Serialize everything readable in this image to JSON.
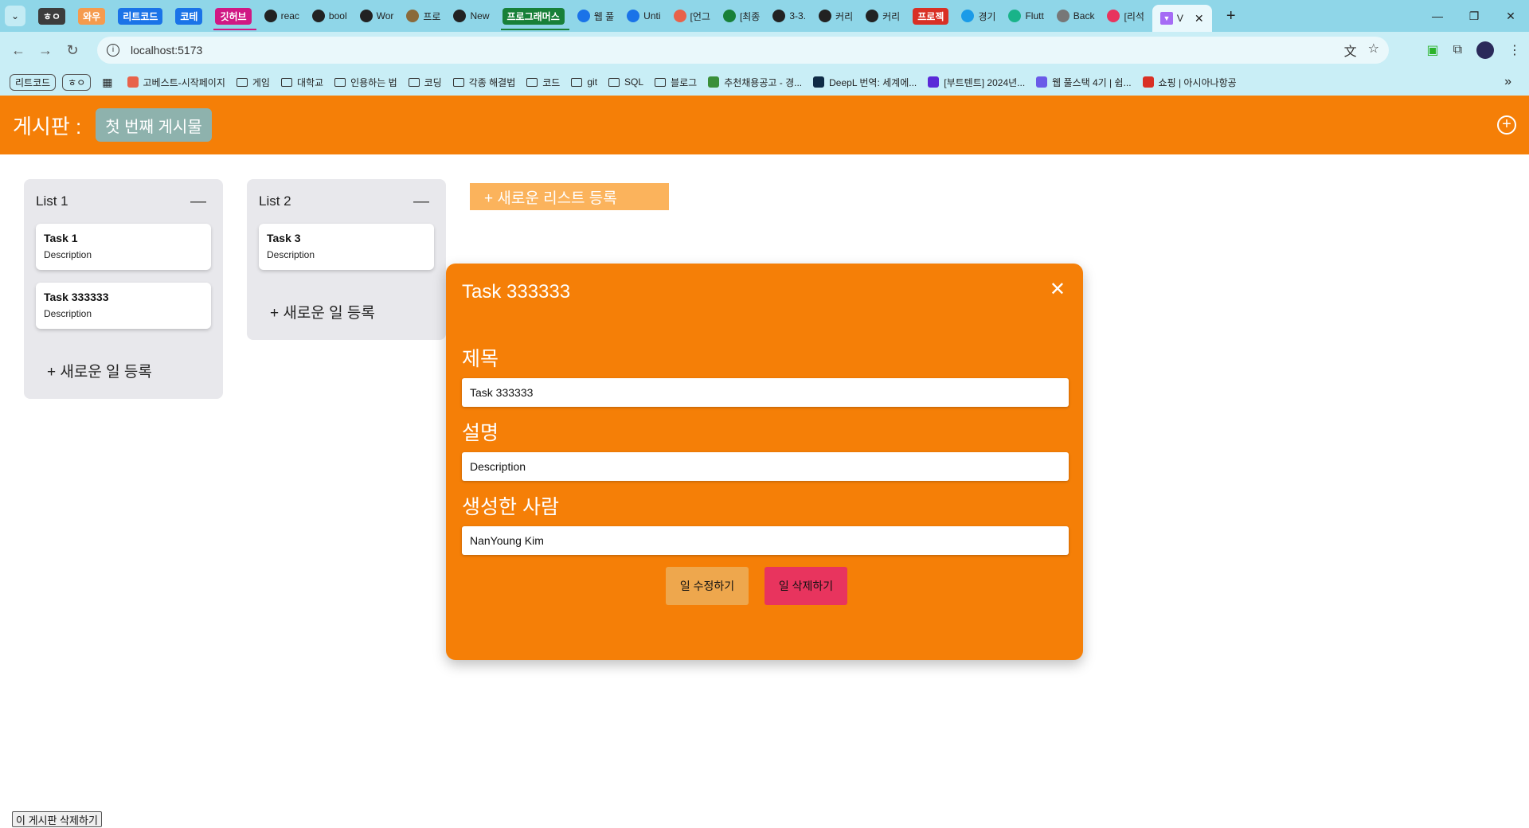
{
  "browser": {
    "tabs": [
      {
        "label": "ㅎㅇ",
        "kind": "badge",
        "bg": "#3c3c3c",
        "fg": "#ffffff"
      },
      {
        "label": "와우",
        "kind": "badge",
        "bg": "#f59b4e",
        "fg": "#ffffff"
      },
      {
        "label": "리트코드",
        "kind": "badge",
        "bg": "#1a73e8",
        "fg": "#ffffff"
      },
      {
        "label": "코테",
        "kind": "badge",
        "bg": "#1a73e8",
        "fg": "#ffffff"
      },
      {
        "label": "깃허브",
        "kind": "badge",
        "bg": "#d01884",
        "fg": "#ffffff",
        "underline": "#d01884"
      },
      {
        "label": "reac",
        "kind": "page",
        "icon": "github",
        "iconbg": "#222222"
      },
      {
        "label": "bool",
        "kind": "page",
        "icon": "github",
        "iconbg": "#222222"
      },
      {
        "label": "Wor",
        "kind": "page",
        "icon": "github",
        "iconbg": "#222222"
      },
      {
        "label": "프로",
        "kind": "page",
        "icon": "image",
        "iconbg": "#8a6a3a"
      },
      {
        "label": "New",
        "kind": "page",
        "icon": "github",
        "iconbg": "#222222"
      },
      {
        "label": "프로그래머스",
        "kind": "badge",
        "bg": "#188038",
        "fg": "#ffffff",
        "underline": "#188038"
      },
      {
        "label": "웹 풀",
        "kind": "page",
        "icon": "four",
        "iconbg": "#1a73e8"
      },
      {
        "label": "Unti",
        "kind": "page",
        "icon": "share",
        "iconbg": "#1a73e8"
      },
      {
        "label": "[언그",
        "kind": "page",
        "icon": "circle",
        "iconbg": "#e8624a"
      },
      {
        "label": "[최종",
        "kind": "page",
        "icon": "sheet",
        "iconbg": "#188038"
      },
      {
        "label": "3-3.",
        "kind": "page",
        "icon": "notion",
        "iconbg": "#222222"
      },
      {
        "label": "커리",
        "kind": "page",
        "icon": "notion",
        "iconbg": "#222222"
      },
      {
        "label": "커리",
        "kind": "page",
        "icon": "notion",
        "iconbg": "#222222"
      },
      {
        "label": "프로젝",
        "kind": "badge",
        "bg": "#d93025",
        "fg": "#ffffff"
      },
      {
        "label": "경기",
        "kind": "page",
        "icon": "circle",
        "iconbg": "#1a9be8"
      },
      {
        "label": "Flutt",
        "kind": "page",
        "icon": "v",
        "iconbg": "#19b389"
      },
      {
        "label": "Back",
        "kind": "page",
        "icon": "circle",
        "iconbg": "#777777"
      },
      {
        "label": "[리석",
        "kind": "page",
        "icon": "heart",
        "iconbg": "#e8345e"
      }
    ],
    "active_tab": {
      "label": "V",
      "close": "✕"
    },
    "new_tab": "+",
    "window_controls": [
      "—",
      "❐",
      "✕"
    ],
    "url": "localhost:5173",
    "bookmarks_pills": [
      "리트코드",
      "ㅎㅇ"
    ],
    "bookmarks": [
      {
        "label": "고베스트-시작페이지",
        "type": "fav",
        "color": "#e8624a"
      },
      {
        "label": "게임",
        "type": "folder"
      },
      {
        "label": "대학교",
        "type": "folder"
      },
      {
        "label": "인용하는 법",
        "type": "folder"
      },
      {
        "label": "코딩",
        "type": "folder"
      },
      {
        "label": "각종 해결법",
        "type": "folder"
      },
      {
        "label": "코드",
        "type": "folder"
      },
      {
        "label": "git",
        "type": "folder"
      },
      {
        "label": "SQL",
        "type": "folder"
      },
      {
        "label": "블로그",
        "type": "folder"
      },
      {
        "label": "추천채용공고 - 경...",
        "type": "fav",
        "color": "#3a8f3a"
      },
      {
        "label": "DeepL 번역: 세계에...",
        "type": "fav",
        "color": "#0f2b46"
      },
      {
        "label": "[부트텐트] 2024년...",
        "type": "fav",
        "color": "#5a2ad8"
      },
      {
        "label": "웹 풀스택 4기 | 쉽...",
        "type": "fav",
        "color": "#6a5ae8"
      },
      {
        "label": "쇼핑 | 아시아나항공",
        "type": "fav",
        "color": "#d93025"
      }
    ]
  },
  "app": {
    "header": {
      "label": "게시판 :",
      "board_title": "첫 번째 게시물",
      "add_icon": "⊕"
    },
    "lists": [
      {
        "title": "List 1",
        "collapse": "—",
        "cards": [
          {
            "title": "Task 1",
            "desc": "Description"
          },
          {
            "title": "Task 333333",
            "desc": "Description"
          }
        ],
        "add_task": "+ 새로운 일 등록"
      },
      {
        "title": "List 2",
        "collapse": "—",
        "cards": [
          {
            "title": "Task 3",
            "desc": "Description"
          }
        ],
        "add_task": "+ 새로운 일 등록"
      }
    ],
    "new_list_button": "+ 새로운 리스트 등록",
    "modal": {
      "title": "Task 333333",
      "close": "✕",
      "fields": [
        {
          "label": "제목",
          "value": "Task 333333"
        },
        {
          "label": "설명",
          "value": "Description"
        },
        {
          "label": "생성한 사람",
          "value": "NanYoung Kim"
        }
      ],
      "edit_button": "일 수정하기",
      "delete_button": "일 삭제하기"
    },
    "delete_board_button": "이 게시판 삭제하기"
  },
  "colors": {
    "accent": "#f57f07",
    "board_title_bg": "#8eb2ad",
    "list_bg": "#e8e8ec",
    "new_list_bg": "#fbb35c",
    "edit_bg": "#eea74d",
    "delete_bg": "#e8345e"
  }
}
